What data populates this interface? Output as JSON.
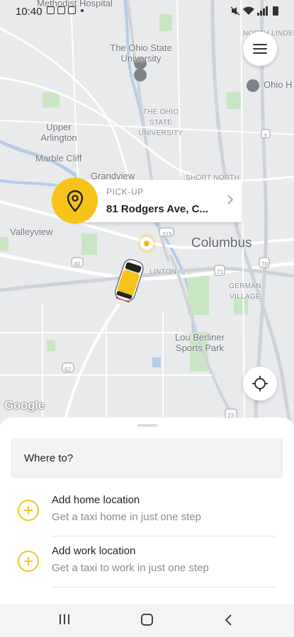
{
  "status_bar": {
    "time": "10:40",
    "notification_icons": [
      "image-icon",
      "chat-icon",
      "chat-icon",
      "dot-icon"
    ],
    "system_icons": [
      "mute-icon",
      "wifi-icon",
      "signal-icon",
      "battery-icon"
    ]
  },
  "map": {
    "labels": {
      "hospital": "Methodist Hospital",
      "osu": "The Ohio State University",
      "osu_small": "THE OHIO STATE UNIVERSITY",
      "north_linden": "NORTH LINDEN",
      "ohio_h": "Ohio H",
      "upper_arlington": "Upper Arlington",
      "marble_cliff": "Marble Cliff",
      "grandview": "Grandview",
      "short_north": "SHORT NORTH",
      "valleyview": "Valleyview",
      "columbus": "Columbus",
      "hilltop_fragment": "LINTON",
      "german_village": "GERMAN VILLAGE",
      "lou_berliner": "Lou Berliner Sports Park",
      "route_315": "315",
      "route_71": "71",
      "route_70": "70",
      "route_40": "40",
      "route_62": "62",
      "route_23": "23",
      "route_3": "3",
      "google": "Google"
    },
    "accent_color": "#f6c31b"
  },
  "pickup": {
    "title": "PICK-UP",
    "address": "81 Rodgers Ave, C...",
    "icon": "location-pin-icon"
  },
  "controls": {
    "menu_icon": "hamburger-menu-icon",
    "recenter_icon": "crosshair-icon"
  },
  "sheet": {
    "where_to": "Where to?",
    "items": [
      {
        "title": "Add home location",
        "subtitle": "Get a taxi home in just one step",
        "icon": "plus-circle-icon"
      },
      {
        "title": "Add work location",
        "subtitle": "Get a taxi to work in just one step",
        "icon": "plus-circle-icon"
      }
    ]
  },
  "nav": {
    "recents_icon": "recents-icon",
    "home_icon": "home-icon",
    "back_icon": "back-icon"
  }
}
